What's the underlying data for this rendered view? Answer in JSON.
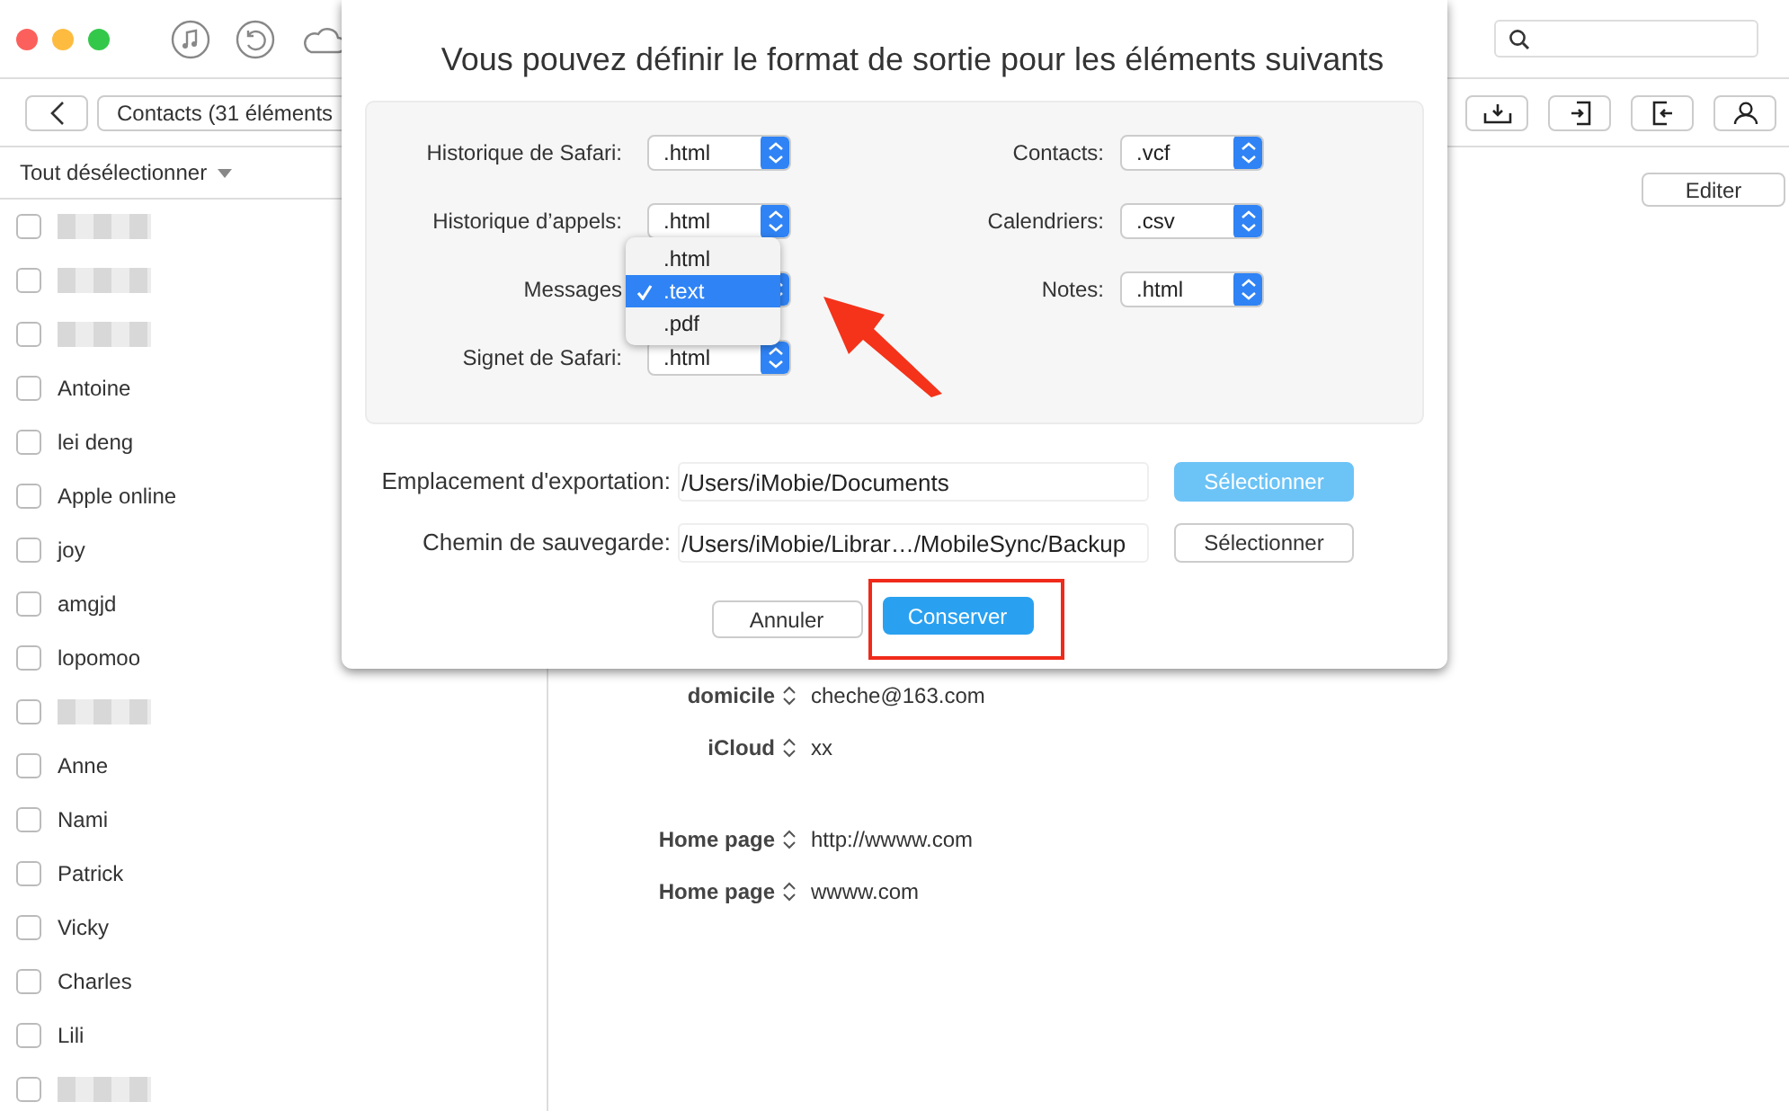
{
  "breadcrumb": "Contacts (31 éléments",
  "list_header": "Tout désélectionner",
  "contacts": [
    {
      "kind": "redacted",
      "checked": false
    },
    {
      "kind": "redacted",
      "checked": false
    },
    {
      "kind": "redacted",
      "checked": false
    },
    {
      "kind": "name",
      "name": "Antoine",
      "checked": false
    },
    {
      "kind": "name",
      "name": "lei deng",
      "checked": false
    },
    {
      "kind": "name",
      "name": "Apple online",
      "checked": false
    },
    {
      "kind": "name",
      "name": "joy",
      "checked": false
    },
    {
      "kind": "name",
      "name": "amgjd",
      "checked": false
    },
    {
      "kind": "name",
      "name": "lopomoo",
      "checked": false
    },
    {
      "kind": "redacted",
      "checked": false
    },
    {
      "kind": "name",
      "name": "Anne",
      "checked": false
    },
    {
      "kind": "name",
      "name": "Nami",
      "checked": false
    },
    {
      "kind": "name",
      "name": "Patrick",
      "checked": false
    },
    {
      "kind": "name",
      "name": "Vicky",
      "checked": false
    },
    {
      "kind": "name",
      "name": "Charles",
      "checked": false
    },
    {
      "kind": "name",
      "name": "Lili",
      "checked": false
    },
    {
      "kind": "redacted",
      "checked": false
    }
  ],
  "edit_button": "Editer",
  "detail_groups": [
    {
      "fields": [
        {
          "label": "domicile",
          "value": "cheche@163.com"
        },
        {
          "label": "iCloud",
          "value": "xx"
        }
      ]
    },
    {
      "fields": [
        {
          "label": "Home page",
          "value": "http://wwww.com"
        },
        {
          "label": "Home page",
          "value": "wwww.com"
        }
      ]
    }
  ],
  "dialog": {
    "title": "Vous pouvez définir le format de sortie pour les éléments suivants",
    "left_formats": [
      {
        "label": "Historique de Safari:",
        "value": ".html",
        "open": false
      },
      {
        "label": "Historique d’appels:",
        "value": ".html",
        "open": false
      },
      {
        "label": "Messages",
        "open": true,
        "menu": [
          {
            "label": ".html",
            "selected": false
          },
          {
            "label": ".text",
            "selected": true
          },
          {
            "label": ".pdf",
            "selected": false
          }
        ]
      },
      {
        "label": "Signet de Safari:",
        "value": ".html",
        "open": false
      }
    ],
    "right_formats": [
      {
        "label": "Contacts:",
        "value": ".vcf",
        "open": false
      },
      {
        "label": "Calendriers:",
        "value": ".csv",
        "open": false
      },
      {
        "label": "Notes:",
        "value": ".html",
        "open": false
      }
    ],
    "paths": [
      {
        "label": "Emplacement d'exportation:",
        "value": "/Users/iMobie/Documents",
        "button": "Sélectionner",
        "kind": "primary"
      },
      {
        "label": "Chemin de sauvegarde:",
        "value": "/Users/iMobie/Librar…/MobileSync/Backup",
        "button": "Sélectionner",
        "kind": "default"
      }
    ],
    "buttons": [
      {
        "label": "Annuler",
        "kind": "default"
      },
      {
        "label": "Conserver",
        "kind": "primary"
      }
    ]
  }
}
